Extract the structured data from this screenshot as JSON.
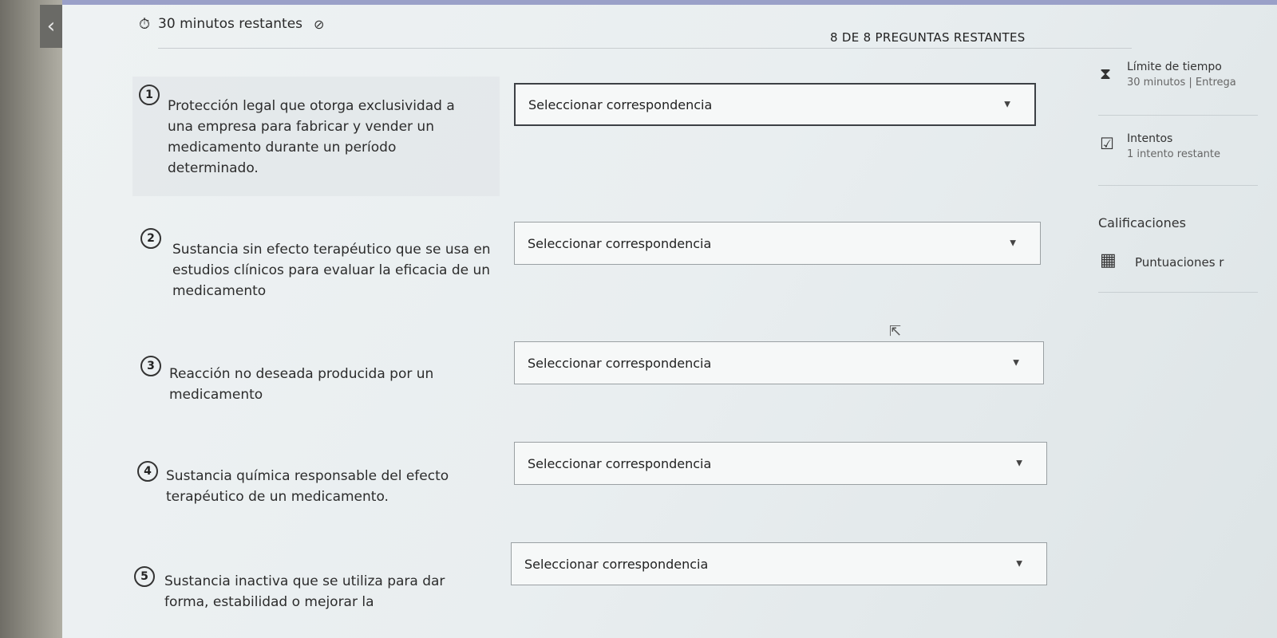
{
  "nav": {
    "back_glyph": "‹"
  },
  "header": {
    "timer_text": "30 minutos restantes",
    "questions_remaining": "8 DE 8 PREGUNTAS RESTANTES"
  },
  "questions": [
    {
      "number": "1",
      "text": "Protección legal que otorga exclusividad a una empresa para fabricar y vender un medicamento durante un período determinado.",
      "select_value": "Seleccionar correspondencia"
    },
    {
      "number": "2",
      "text": "Sustancia sin efecto terapéutico que se usa en estudios clínicos para evaluar la eficacia de un medicamento",
      "select_value": "Seleccionar correspondencia"
    },
    {
      "number": "3",
      "text": "Reacción no deseada producida por un medicamento",
      "select_value": "Seleccionar correspondencia"
    },
    {
      "number": "4",
      "text": "Sustancia química responsable del efecto terapéutico de un medicamento.",
      "select_value": "Seleccionar correspondencia"
    },
    {
      "number": "5",
      "text": "Sustancia inactiva que se utiliza para dar forma, estabilidad o mejorar la",
      "select_value": "Seleccionar correspondencia"
    }
  ],
  "sidebar": {
    "time_limit_title": "Límite de tiempo",
    "time_limit_sub": "30 minutos | Entrega",
    "attempts_title": "Intentos",
    "attempts_sub": "1 intento restante",
    "grades_heading": "Calificaciones",
    "scores_label": "Puntuaciones r"
  },
  "icons": {
    "timer": "clock-icon",
    "visibility": "eye-slash-icon",
    "hourglass": "hourglass-icon",
    "attempts": "checkbox-icon",
    "scores": "grid-icon",
    "cursor": "mouse-pointer-icon"
  },
  "colors": {
    "accent_bar": "#9aa0c8",
    "background": "#e9eef0"
  }
}
